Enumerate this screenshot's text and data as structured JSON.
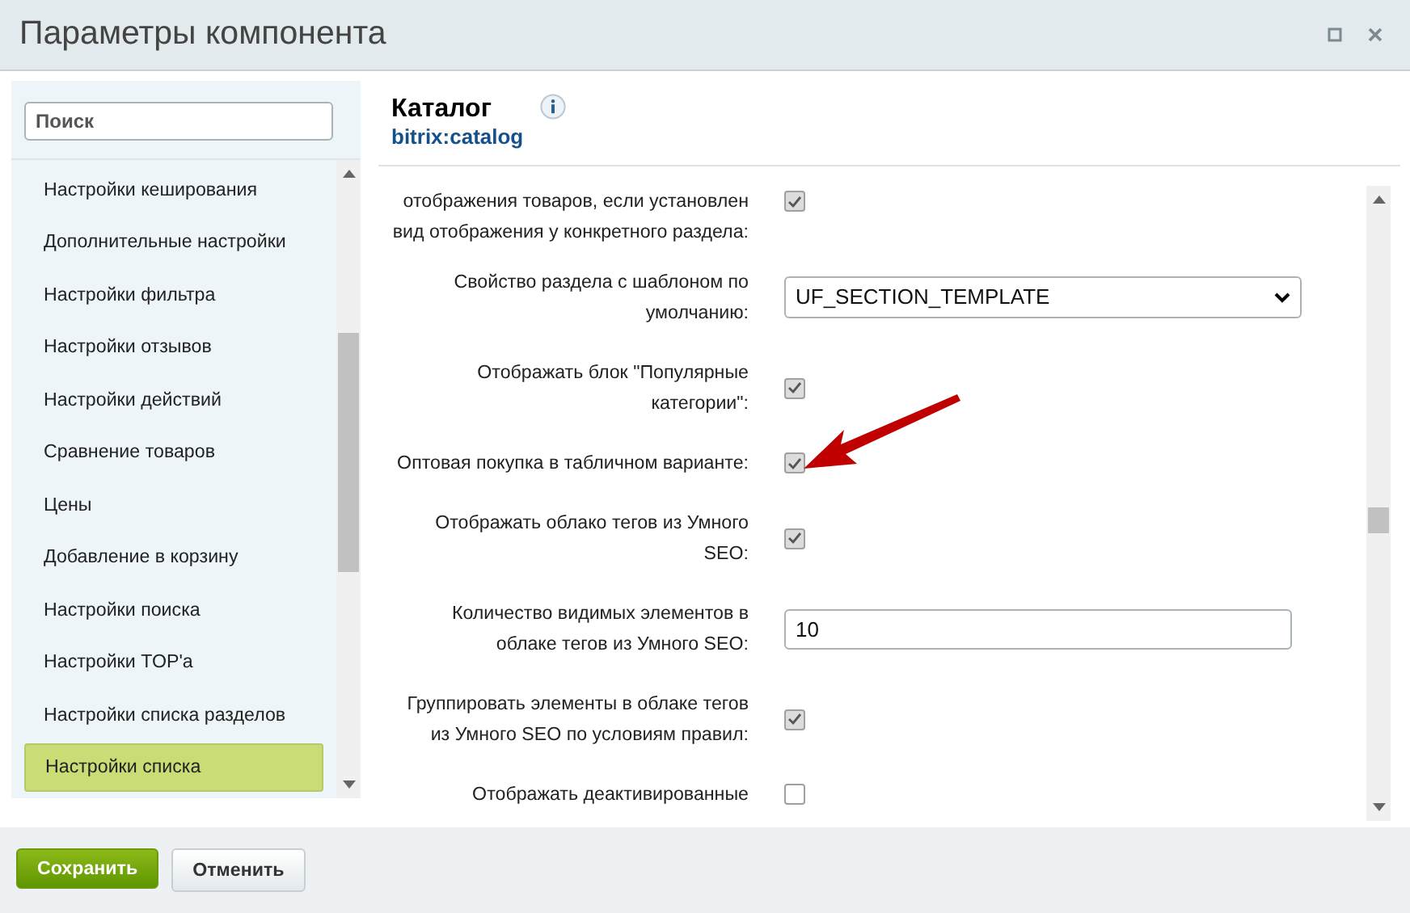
{
  "window": {
    "title": "Параметры компонента"
  },
  "sidebar": {
    "search": {
      "placeholder": "Поиск"
    },
    "items": [
      {
        "label": "Настройки кеширования",
        "selected": false
      },
      {
        "label": "Дополнительные настройки",
        "selected": false
      },
      {
        "label": "Настройки фильтра",
        "selected": false
      },
      {
        "label": "Настройки отзывов",
        "selected": false
      },
      {
        "label": "Настройки действий",
        "selected": false
      },
      {
        "label": "Сравнение товаров",
        "selected": false
      },
      {
        "label": "Цены",
        "selected": false
      },
      {
        "label": "Добавление в корзину",
        "selected": false
      },
      {
        "label": "Настройки поиска",
        "selected": false
      },
      {
        "label": "Настройки TOP'а",
        "selected": false
      },
      {
        "label": "Настройки списка разделов",
        "selected": false
      },
      {
        "label": "Настройки списка",
        "selected": true
      }
    ]
  },
  "component": {
    "title": "Каталог",
    "code": "bitrix:catalog"
  },
  "settings": [
    {
      "kind": "checkbox",
      "label": "отображения товаров, если установлен вид отображения у конкретного раздела:",
      "checked": true
    },
    {
      "kind": "select",
      "label": "Свойство раздела с шаблоном по умолчанию:",
      "value": "UF_SECTION_TEMPLATE"
    },
    {
      "kind": "checkbox",
      "label": "Отображать блок \"Популярные категории\":",
      "checked": true
    },
    {
      "kind": "checkbox",
      "label": "Оптовая покупка в табличном варианте:",
      "checked": true
    },
    {
      "kind": "checkbox",
      "label": "Отображать облако тегов из Умного SEO:",
      "checked": true
    },
    {
      "kind": "text",
      "label": "Количество видимых элементов в облаке тегов из Умного SEO:",
      "value": "10"
    },
    {
      "kind": "checkbox",
      "label": "Группировать элементы в облаке тегов из Умного SEO по условиям правил:",
      "checked": true
    },
    {
      "kind": "checkbox",
      "label": "Отображать деактивированные",
      "checked": false
    }
  ],
  "buttons": [
    {
      "label": "Сохранить",
      "kind": "primary"
    },
    {
      "label": "Отменить",
      "kind": "secondary"
    }
  ]
}
